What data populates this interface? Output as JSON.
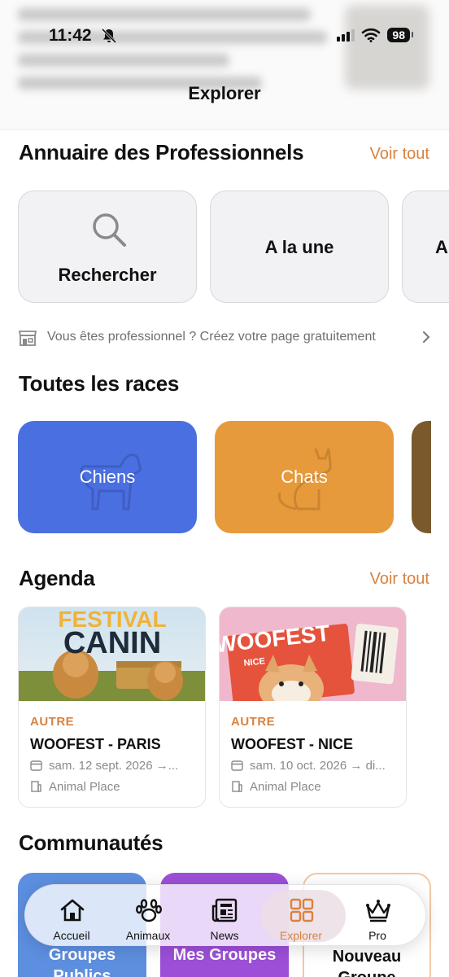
{
  "status_bar": {
    "time": "11:42",
    "battery": "98"
  },
  "nav": {
    "title": "Explorer"
  },
  "directory": {
    "title": "Annuaire des Professionnels",
    "see_all": "Voir tout",
    "cards": [
      {
        "label": "Rechercher",
        "icon": "search-icon"
      },
      {
        "label": "A la une"
      },
      {
        "label": "A"
      }
    ],
    "promo": "Vous êtes professionnel ? Créez votre page gratuitement"
  },
  "races": {
    "title": "Toutes les races",
    "cards": [
      {
        "label": "Chiens",
        "color": "#4a6fe0",
        "icon": "dog-icon"
      },
      {
        "label": "Chats",
        "color": "#e79a3c",
        "icon": "cat-icon"
      },
      {
        "label": "",
        "color": "#7a5a2c"
      }
    ]
  },
  "agenda": {
    "title": "Agenda",
    "see_all": "Voir tout",
    "events": [
      {
        "banner_line1": "FESTIVAL",
        "banner_line2": "CANIN",
        "category": "AUTRE",
        "title": "WOOFEST - PARIS",
        "date": "sam. 12 sept. 2026 →...",
        "place": "Animal Place"
      },
      {
        "banner_line1": "WOOFEST",
        "banner_line2": "NICE",
        "category": "AUTRE",
        "title": "WOOFEST - NICE",
        "date": "sam. 10 oct. 2026 → di...",
        "place": "Animal Place"
      }
    ]
  },
  "communities": {
    "title": "Communautés",
    "cards": [
      {
        "label": "Groupes Publics",
        "color": "#5d8fe0"
      },
      {
        "label": "Mes Groupes",
        "color": "#9d4fd8"
      },
      {
        "label": "Nouveau Groupe",
        "color": "#ffffff"
      }
    ]
  },
  "tabbar": {
    "items": [
      {
        "label": "Accueil",
        "icon": "home-icon"
      },
      {
        "label": "Animaux",
        "icon": "paw-icon"
      },
      {
        "label": "News",
        "icon": "newspaper-icon"
      },
      {
        "label": "Explorer",
        "icon": "grid-icon",
        "active": true
      },
      {
        "label": "Pro",
        "icon": "crown-icon"
      }
    ],
    "accent": "#d9823f"
  }
}
